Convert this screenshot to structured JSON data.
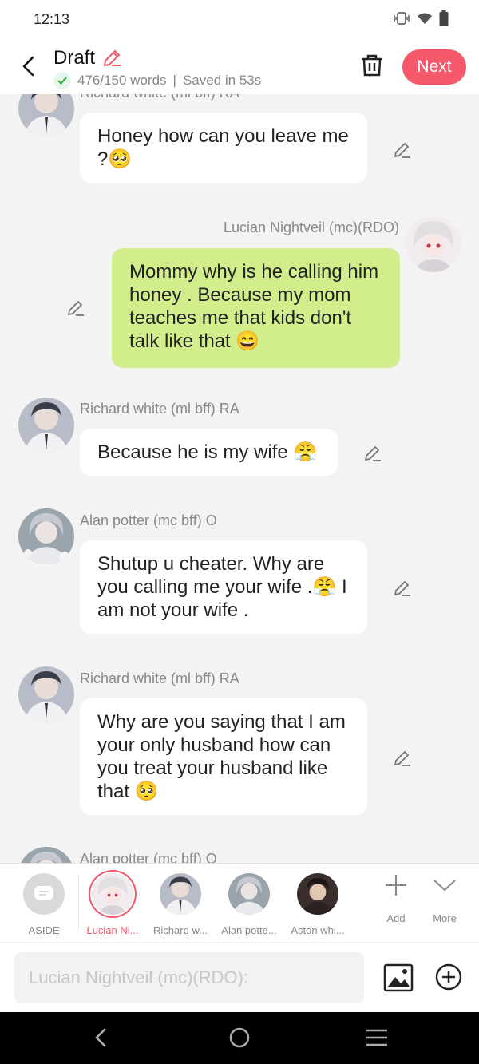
{
  "status_bar": {
    "time": "12:13"
  },
  "header": {
    "title": "Draft",
    "word_count": "476/150 words",
    "separator": "|",
    "saved": "Saved in 53s",
    "next_label": "Next"
  },
  "messages": [
    {
      "sender": "Richard white (ml bff) RA",
      "text": "Honey how can you leave me ?🥺",
      "mine": false
    },
    {
      "sender": "Lucian Nightveil (mc)(RDO)",
      "text": "Mommy why is he calling him honey . Because my mom teaches me that kids don't talk like that 😄",
      "mine": true
    },
    {
      "sender": "Richard white (ml bff) RA",
      "text": "Because he is my wife 😤",
      "mine": false
    },
    {
      "sender": "Alan potter (mc bff) O",
      "text": "Shutup u cheater. Why are you calling me your wife .😤 I am not your wife .",
      "mine": false
    },
    {
      "sender": "Richard white (ml bff) RA",
      "text": "Why are you saying that I am your only husband how can you treat your husband like that 🥺",
      "mine": false
    },
    {
      "sender": "Alan potter (mc bff) O",
      "text": "",
      "mine": false
    }
  ],
  "characters": {
    "aside_label": "ASIDE",
    "items": [
      {
        "label": "Lucian Ni...",
        "selected": true
      },
      {
        "label": "Richard w...",
        "selected": false
      },
      {
        "label": "Alan potte...",
        "selected": false
      },
      {
        "label": "Aston whi...",
        "selected": false
      }
    ],
    "add_label": "Add",
    "more_label": "More"
  },
  "input": {
    "placeholder": "Lucian Nightveil (mc)(RDO):"
  },
  "colors": {
    "accent": "#f4586a",
    "my_bubble": "#d2ed8b",
    "background": "#f3f3f3"
  }
}
